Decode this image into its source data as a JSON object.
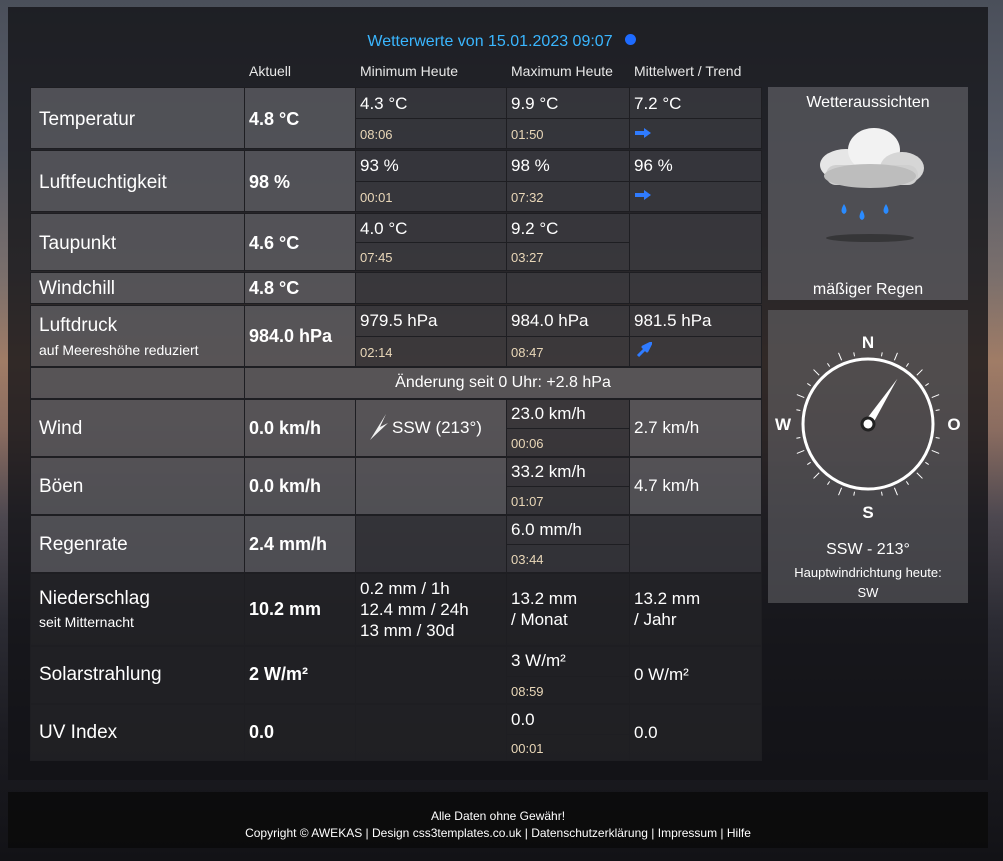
{
  "header": {
    "title": "Wetterwerte von  15.01.2023 09:07",
    "columns": [
      "Aktuell",
      "Minimum Heute",
      "Maximum Heute",
      "Mittelwert / Trend"
    ]
  },
  "rows": {
    "temperatur": {
      "label": "Temperatur",
      "current": "4.8 °C",
      "min": "4.3 °C",
      "min_time": "08:06",
      "max": "9.9 °C",
      "max_time": "01:50",
      "avg": "7.2 °C",
      "trend": "steady-arrow-icon"
    },
    "luftfeuchtigkeit": {
      "label": "Luftfeuchtigkeit",
      "current": "98 %",
      "min": "93 %",
      "min_time": "00:01",
      "max": "98 %",
      "max_time": "07:32",
      "avg": "96 %",
      "trend": "steady-arrow-icon"
    },
    "taupunkt": {
      "label": "Taupunkt",
      "current": "4.6 °C",
      "min": "4.0 °C",
      "min_time": "07:45",
      "max": "9.2 °C",
      "max_time": "03:27"
    },
    "windchill": {
      "label": "Windchill",
      "current": "4.8 °C"
    },
    "luftdruck": {
      "label": "Luftdruck",
      "sublabel": "auf Meereshöhe reduziert",
      "current": "984.0 hPa",
      "min": "979.5 hPa",
      "min_time": "02:14",
      "max": "984.0 hPa",
      "max_time": "08:47",
      "avg": "981.5 hPa",
      "trend": "rising-arrow-icon",
      "change": "Änderung seit 0 Uhr: +2.8 hPa"
    },
    "wind": {
      "label": "Wind",
      "current": "0.0 km/h",
      "direction": "SSW (213°)",
      "max": "23.0 km/h",
      "max_time": "00:06",
      "avg": "2.7 km/h"
    },
    "boeen": {
      "label": "Böen",
      "current": "0.0 km/h",
      "max": "33.2 km/h",
      "max_time": "01:07",
      "avg": "4.7 km/h"
    },
    "regenrate": {
      "label": "Regenrate",
      "current": "2.4 mm/h",
      "max": "6.0 mm/h",
      "max_time": "03:44"
    },
    "niederschlag": {
      "label": "Niederschlag",
      "sublabel": "seit Mitternacht",
      "current": "10.2 mm",
      "periods": [
        "0.2 mm / 1h",
        "12.4 mm / 24h",
        "13 mm / 30d"
      ],
      "month": [
        "13.2 mm",
        "/ Monat"
      ],
      "year": [
        "13.2 mm",
        "/ Jahr"
      ]
    },
    "solar": {
      "label": "Solarstrahlung",
      "current": "2 W/m²",
      "max": "3 W/m²",
      "max_time": "08:59",
      "avg": "0 W/m²"
    },
    "uv": {
      "label": "UV Index",
      "current": "0.0",
      "max": "0.0",
      "max_time": "00:01",
      "avg": "0.0"
    }
  },
  "forecast": {
    "title": "Wetteraussichten",
    "icon": "rain-cloud-icon",
    "text": "mäßiger Regen"
  },
  "compass": {
    "n": "N",
    "s": "S",
    "w": "W",
    "o": "O",
    "direction": "SSW -  213°",
    "main_label": "Hauptwindrichtung heute:",
    "main_value": "SW",
    "angle_deg": 213
  },
  "footer": {
    "disclaimer": "Alle Daten ohne Gewähr!",
    "copyright": "Copyright © AWEKAS",
    "links": [
      "Design css3templates.co.uk",
      "Datenschutzerklärung",
      "Impressum",
      "Hilfe"
    ]
  },
  "colors": {
    "accent": "#3ab6ff",
    "trend_arrow": "#2f7bff",
    "time": "#e9d7b8"
  }
}
